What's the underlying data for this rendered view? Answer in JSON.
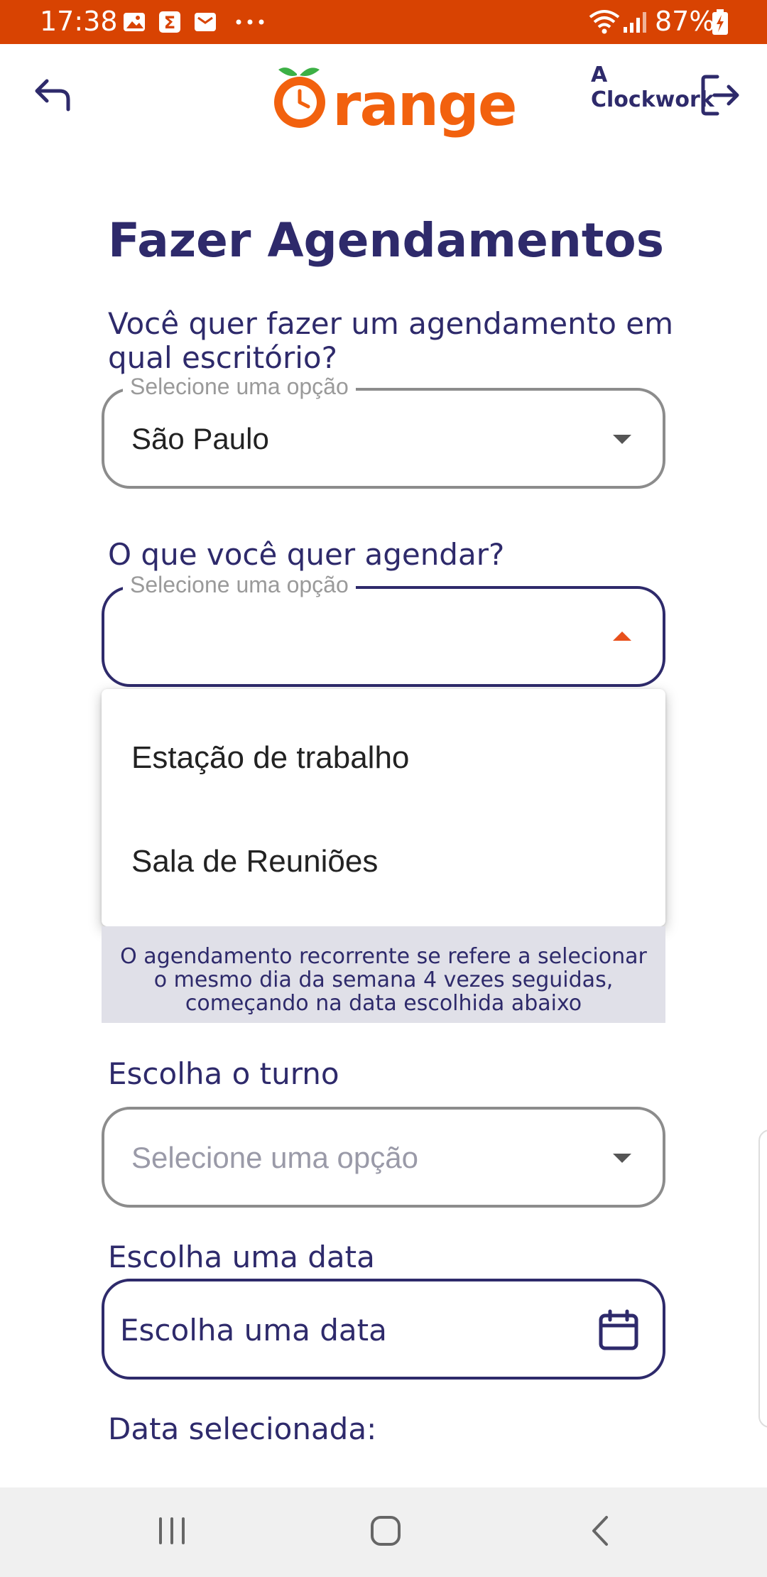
{
  "status_bar": {
    "time": "17:38",
    "battery": "87%",
    "bg_color": "#d84302"
  },
  "header": {
    "logo_small": "A Clockwork",
    "logo_big": "range",
    "brand_orange": "#f2610e",
    "brand_navy": "#2e2a6b"
  },
  "page": {
    "title": "Fazer Agendamentos"
  },
  "office": {
    "question": "Você quer fazer um agendamento em qual escritório?",
    "legend": "Selecione uma opção",
    "value": "São Paulo"
  },
  "what": {
    "question": "O que você quer agendar?",
    "legend": "Selecione uma opção",
    "value": ""
  },
  "dropdown": {
    "options": [
      "Estação de trabalho",
      "Sala de Reuniões"
    ]
  },
  "info": {
    "text": "O agendamento recorrente se refere a selecionar o mesmo dia da semana 4 vezes seguidas, começando na data escolhida abaixo"
  },
  "shift": {
    "label": "Escolha o turno",
    "placeholder": "Selecione uma opção"
  },
  "date": {
    "label": "Escolha uma data",
    "placeholder": "Escolha uma data"
  },
  "selected_date": {
    "label": "Data selecionada:"
  }
}
